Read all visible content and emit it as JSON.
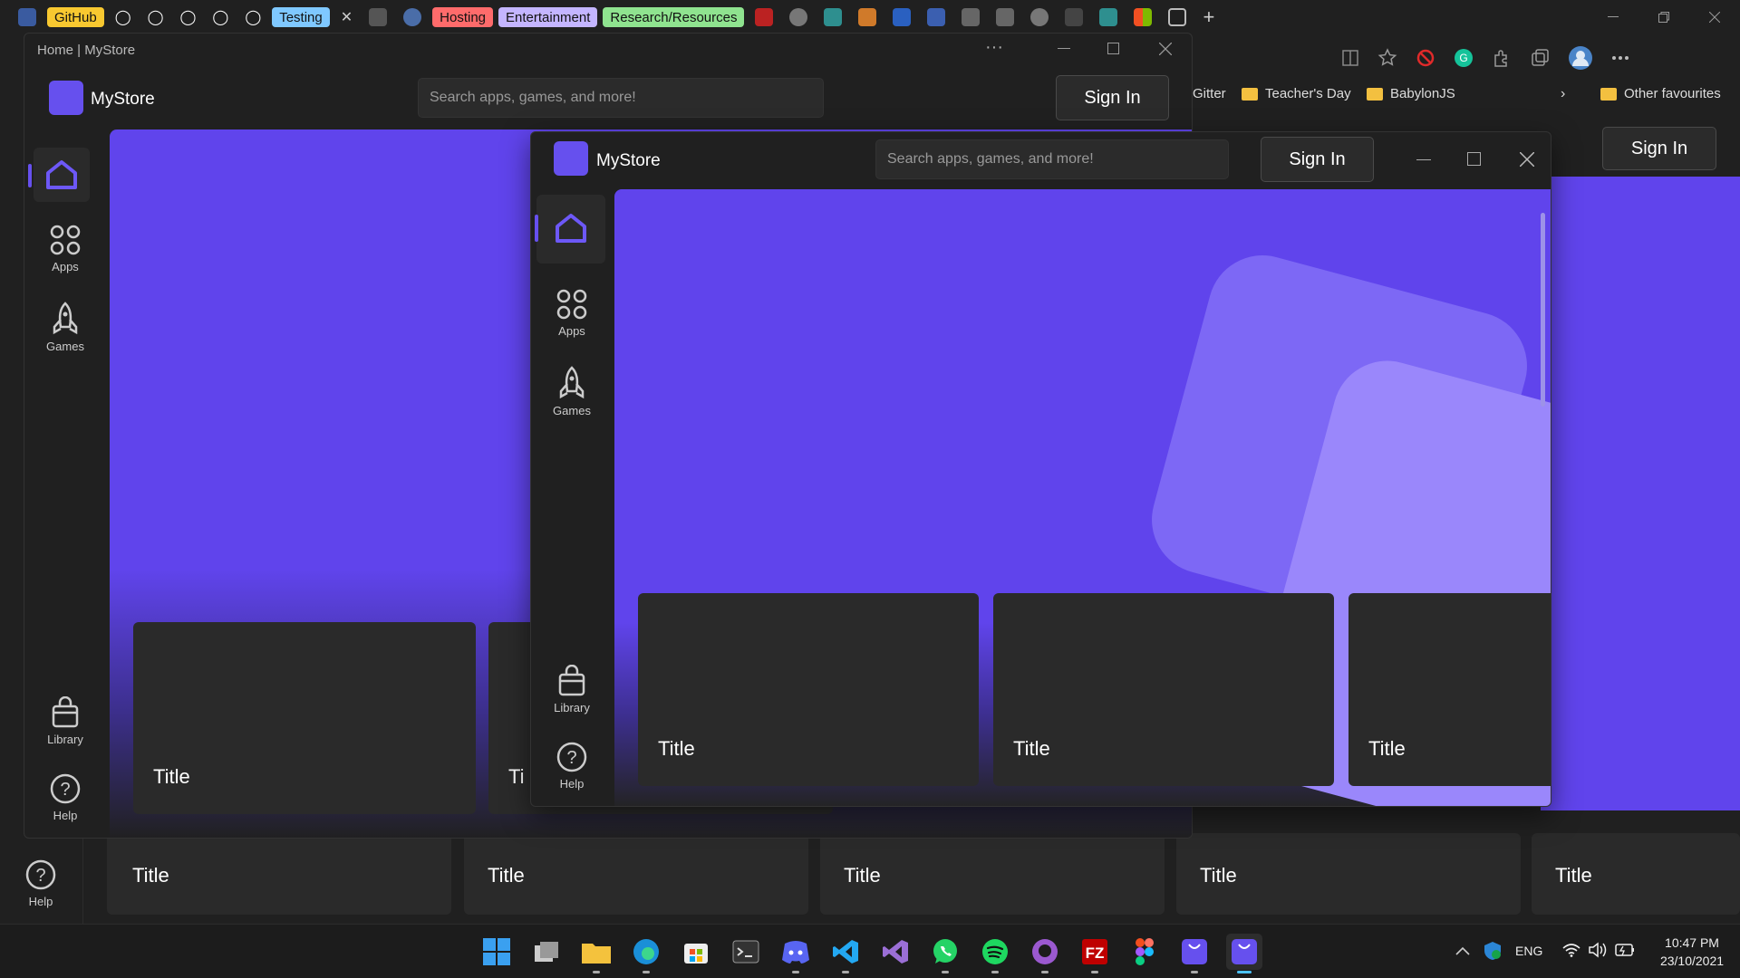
{
  "browser": {
    "tab_groups": [
      {
        "label": "GitHub",
        "color": "#f8c830"
      },
      {
        "label": "Testing",
        "color": "#7fc8ff"
      },
      {
        "label": "Hosting",
        "color": "#ff6b6b"
      },
      {
        "label": "Entertainment",
        "color": "#c4b5ff"
      },
      {
        "label": "Research/Resources",
        "color": "#8fe38f"
      }
    ],
    "favourites": [
      {
        "label": "Gitter"
      },
      {
        "label": "Teacher's Day"
      },
      {
        "label": "BabylonJS"
      },
      {
        "label": "Other favourites"
      }
    ]
  },
  "window_back": {
    "breadcrumb": "Home | MyStore",
    "app_name": "MyStore",
    "search_placeholder": "Search apps, games, and more!",
    "sign_in": "Sign In",
    "nav": {
      "apps": "Apps",
      "games": "Games",
      "library": "Library",
      "help": "Help"
    },
    "cards": [
      {
        "title": "Title"
      },
      {
        "title": "Ti"
      }
    ]
  },
  "window_front": {
    "app_name": "MyStore",
    "search_placeholder": "Search apps, games, and more!",
    "sign_in": "Sign In",
    "nav": {
      "apps": "Apps",
      "games": "Games",
      "library": "Library",
      "help": "Help"
    },
    "cards": [
      {
        "title": "Title"
      },
      {
        "title": "Title"
      },
      {
        "title": "Title"
      }
    ]
  },
  "background_page": {
    "sign_in": "Sign In",
    "help": "Help",
    "cards": [
      {
        "title": "Title"
      },
      {
        "title": "Title"
      },
      {
        "title": "Title"
      },
      {
        "title": "Title"
      },
      {
        "title": "Title"
      }
    ]
  },
  "taskbar": {
    "language": "ENG",
    "time": "10:47 PM",
    "date": "23/10/2021",
    "apps": [
      "windows-start",
      "task-view",
      "file-explorer",
      "edge",
      "microsoft-store",
      "terminal",
      "discord",
      "vscode",
      "visual-studio",
      "whatsapp",
      "spotify",
      "github-desktop",
      "filezilla",
      "figma",
      "mystore",
      "mystore-active"
    ]
  },
  "colors": {
    "accent": "#6044ec",
    "shape_light": "#7d68f5",
    "shape_lighter": "#9a87fb"
  }
}
